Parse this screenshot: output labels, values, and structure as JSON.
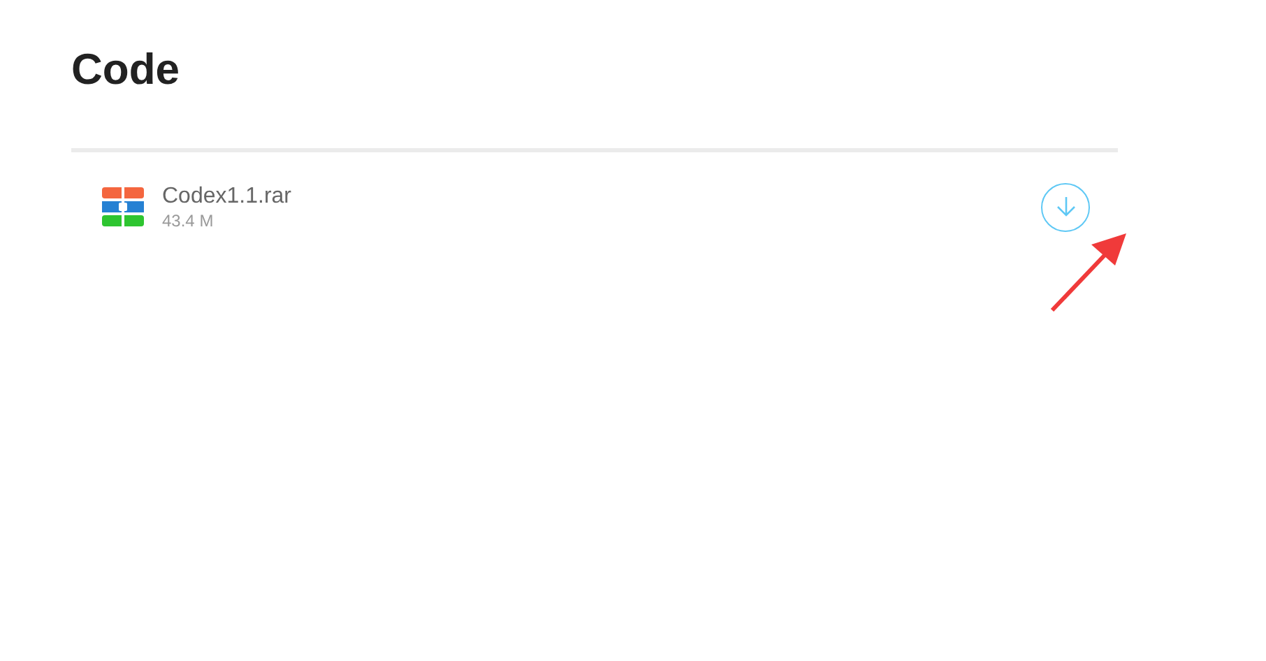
{
  "page": {
    "title": "Code"
  },
  "files": [
    {
      "name": "Codex1.1.rar",
      "size": "43.4 M"
    }
  ]
}
